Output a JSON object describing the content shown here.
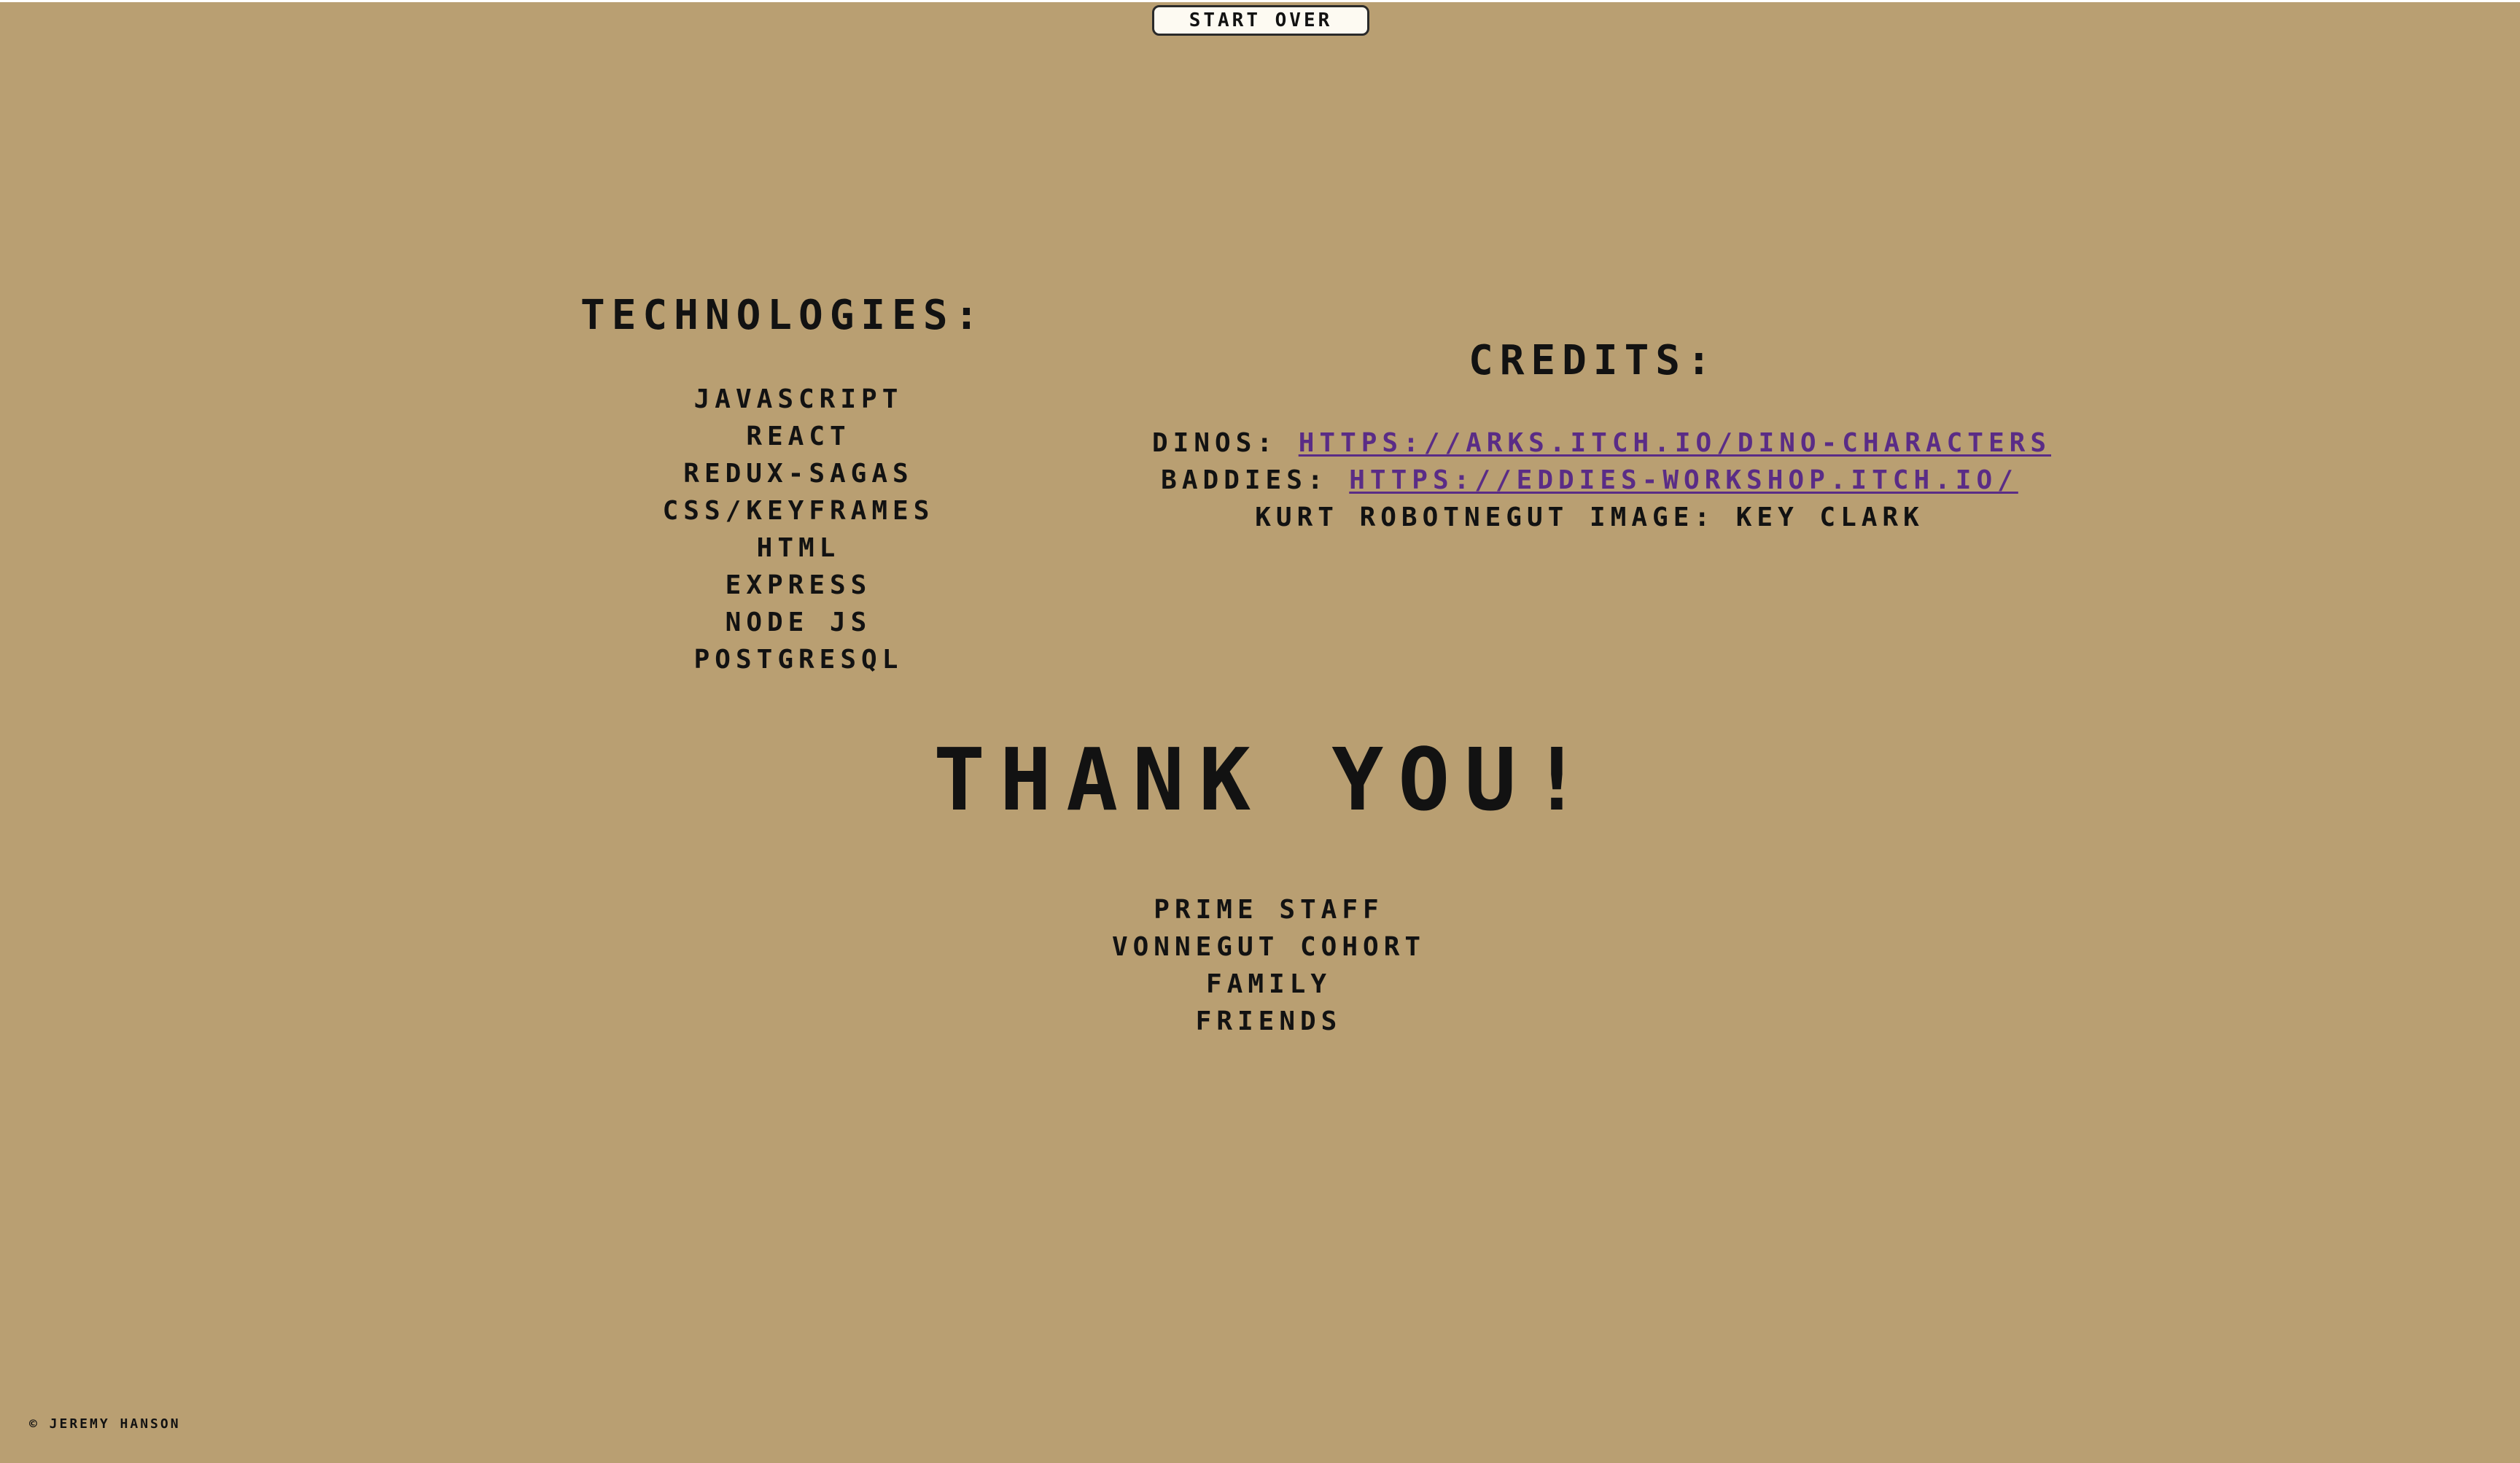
{
  "header": {
    "start_over_label": "Start Over"
  },
  "technologies": {
    "heading": "Technologies:",
    "items": [
      "JavaScript",
      "React",
      "Redux-Sagas",
      "CSS/Keyframes",
      "HTML",
      "Express",
      "Node JS",
      "PostgreSQL"
    ]
  },
  "credits": {
    "heading": "Credits:",
    "dinos_label": "Dinos:",
    "dinos_link": "https://arks.itch.io/dino-characters",
    "baddies_label": "Baddies:",
    "baddies_link": "https://eddies-workshop.itch.io/",
    "image_credit": "Kurt Robotnegut Image: Key Clark"
  },
  "thanks": {
    "title": "Thank You!",
    "items": [
      "Prime Staff",
      "Vonnegut Cohort",
      "Family",
      "Friends"
    ]
  },
  "footer": {
    "copyright": "© Jeremy Hanson"
  },
  "colors": {
    "background": "#b99f72",
    "link": "#5a2c86",
    "button_bg": "#fdfaf2"
  }
}
